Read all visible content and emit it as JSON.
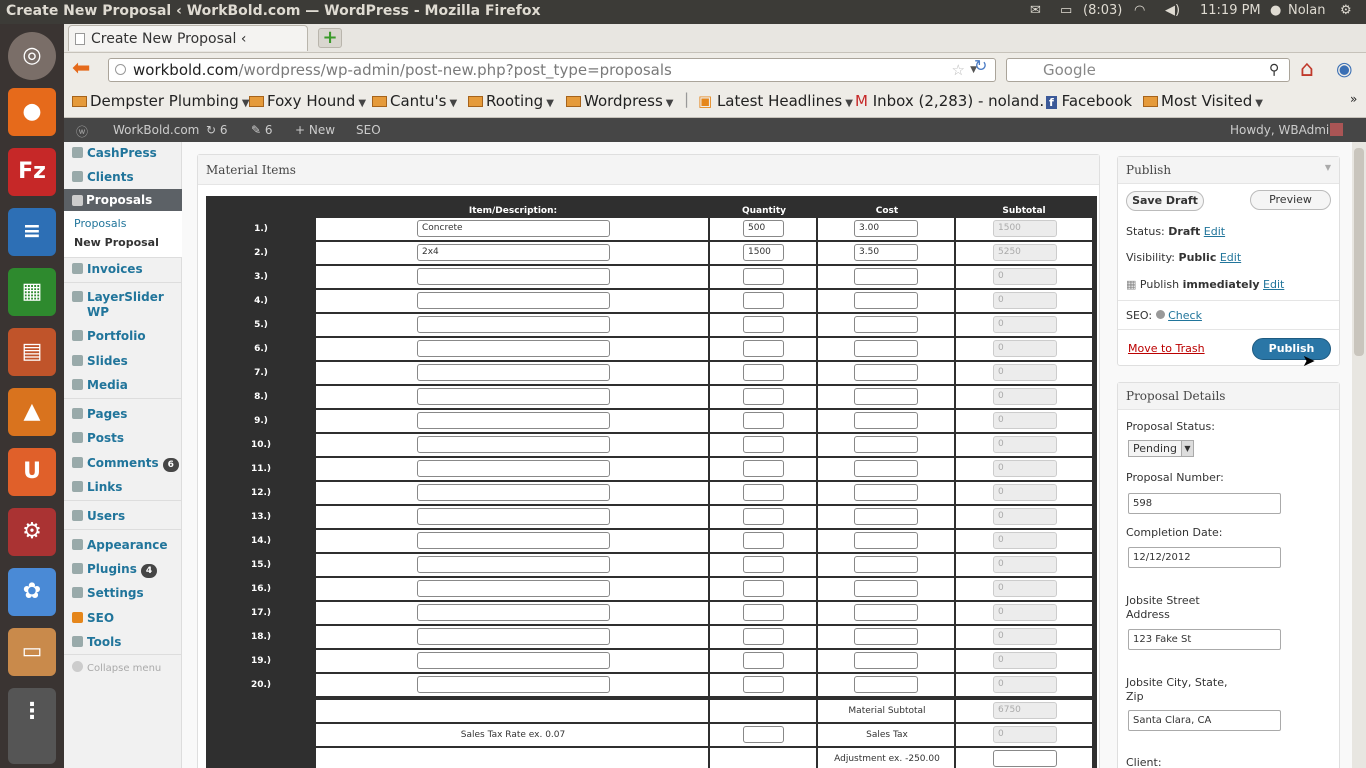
{
  "os_bar": {
    "window_title": "Create New Proposal ‹ WorkBold.com — WordPress - Mozilla Firefox",
    "battery": "(8:03)",
    "clock": "11:19 PM",
    "user": "Nolan"
  },
  "launcher": {
    "items": [
      "ubuntu-icon",
      "firefox-icon",
      "filezilla-icon",
      "writer-icon",
      "calc-icon",
      "impress-icon",
      "software-center-icon",
      "ubuntu-one-icon",
      "settings-icon",
      "picasa-icon",
      "workspaces-icon"
    ]
  },
  "browser": {
    "tab_title": "Create New Proposal ‹ WorkB…",
    "url_host": "workbold.com",
    "url_path": "/wordpress/wp-admin/post-new.php?post_type=proposals",
    "search_placeholder": "Google",
    "bookmarks": [
      {
        "label": "Dempster Plumbing"
      },
      {
        "label": "Foxy Hound"
      },
      {
        "label": "Cantu's"
      },
      {
        "label": "Rooting"
      },
      {
        "label": "Wordpress"
      },
      {
        "label": "Latest Headlines"
      },
      {
        "label": "Inbox (2,283) - noland…"
      },
      {
        "label": "Facebook"
      },
      {
        "label": "Most Visited"
      }
    ]
  },
  "adminbar": {
    "site": "WorkBold.com",
    "updates": "6",
    "comments": "6",
    "new": "New",
    "seo": "SEO",
    "howdy": "Howdy, WBAdmin"
  },
  "sidebar": {
    "cashpress": "CashPress",
    "clients": "Clients",
    "proposals": "Proposals",
    "sub_proposals": "Proposals",
    "sub_new": "New Proposal",
    "invoices": "Invoices",
    "layerslider": "LayerSlider",
    "layerslider2": "WP",
    "portfolio": "Portfolio",
    "slides": "Slides",
    "media": "Media",
    "pages": "Pages",
    "posts": "Posts",
    "comments": "Comments",
    "comments_count": "6",
    "links": "Links",
    "users": "Users",
    "appearance": "Appearance",
    "plugins": "Plugins",
    "plugins_count": "4",
    "settings": "Settings",
    "seo": "SEO",
    "tools": "Tools",
    "collapse": "Collapse menu"
  },
  "material": {
    "box_title": "Material Items",
    "headers": {
      "item": "Item/Description:",
      "qty": "Quantity",
      "cost": "Cost",
      "subtotal": "Subtotal"
    },
    "rows": [
      {
        "n": "1.)",
        "item": "Concrete",
        "qty": "500",
        "cost": "3.00",
        "sub": "1500"
      },
      {
        "n": "2.)",
        "item": "2x4",
        "qty": "1500",
        "cost": "3.50",
        "sub": "5250"
      },
      {
        "n": "3.)",
        "item": "",
        "qty": "",
        "cost": "",
        "sub": "0"
      },
      {
        "n": "4.)",
        "item": "",
        "qty": "",
        "cost": "",
        "sub": "0"
      },
      {
        "n": "5.)",
        "item": "",
        "qty": "",
        "cost": "",
        "sub": "0"
      },
      {
        "n": "6.)",
        "item": "",
        "qty": "",
        "cost": "",
        "sub": "0"
      },
      {
        "n": "7.)",
        "item": "",
        "qty": "",
        "cost": "",
        "sub": "0"
      },
      {
        "n": "8.)",
        "item": "",
        "qty": "",
        "cost": "",
        "sub": "0"
      },
      {
        "n": "9.)",
        "item": "",
        "qty": "",
        "cost": "",
        "sub": "0"
      },
      {
        "n": "10.)",
        "item": "",
        "qty": "",
        "cost": "",
        "sub": "0"
      },
      {
        "n": "11.)",
        "item": "",
        "qty": "",
        "cost": "",
        "sub": "0"
      },
      {
        "n": "12.)",
        "item": "",
        "qty": "",
        "cost": "",
        "sub": "0"
      },
      {
        "n": "13.)",
        "item": "",
        "qty": "",
        "cost": "",
        "sub": "0"
      },
      {
        "n": "14.)",
        "item": "",
        "qty": "",
        "cost": "",
        "sub": "0"
      },
      {
        "n": "15.)",
        "item": "",
        "qty": "",
        "cost": "",
        "sub": "0"
      },
      {
        "n": "16.)",
        "item": "",
        "qty": "",
        "cost": "",
        "sub": "0"
      },
      {
        "n": "17.)",
        "item": "",
        "qty": "",
        "cost": "",
        "sub": "0"
      },
      {
        "n": "18.)",
        "item": "",
        "qty": "",
        "cost": "",
        "sub": "0"
      },
      {
        "n": "19.)",
        "item": "",
        "qty": "",
        "cost": "",
        "sub": "0"
      },
      {
        "n": "20.)",
        "item": "",
        "qty": "",
        "cost": "",
        "sub": "0"
      }
    ],
    "material_subtotal_label": "Material Subtotal",
    "material_subtotal": "6750",
    "sales_tax_rate_label": "Sales Tax Rate ex. 0.07",
    "sales_tax_rate": "",
    "sales_tax_label": "Sales Tax",
    "sales_tax": "0",
    "adjustment_label": "Adjustment ex. -250.00",
    "adjustment": ""
  },
  "publish": {
    "title": "Publish",
    "save_draft": "Save Draft",
    "preview": "Preview",
    "status_label": "Status:",
    "status_value": "Draft",
    "visibility_label": "Visibility:",
    "visibility_value": "Public",
    "publish_label": "Publish",
    "publish_value": "immediately",
    "edit": "Edit",
    "seo_label": "SEO:",
    "seo_check": "Check",
    "trash": "Move to Trash",
    "publish_button": "Publish"
  },
  "details": {
    "title": "Proposal Details",
    "status_label": "Proposal Status:",
    "status_value": "Pending",
    "number_label": "Proposal Number:",
    "number_value": "598",
    "completion_label": "Completion Date:",
    "completion_value": "12/12/2012",
    "street_label_1": "Jobsite Street",
    "street_label_2": "Address",
    "street_value": "123 Fake St",
    "city_label_1": "Jobsite City, State,",
    "city_label_2": "Zip",
    "city_value": "Santa Clara, CA",
    "client_label": "Client:"
  },
  "colors": {
    "os_bar": "#3c3b37",
    "admin_bar": "#464646",
    "link": "#21759b",
    "publish_button": "#2a76a6",
    "launcher": "#3a3432"
  }
}
